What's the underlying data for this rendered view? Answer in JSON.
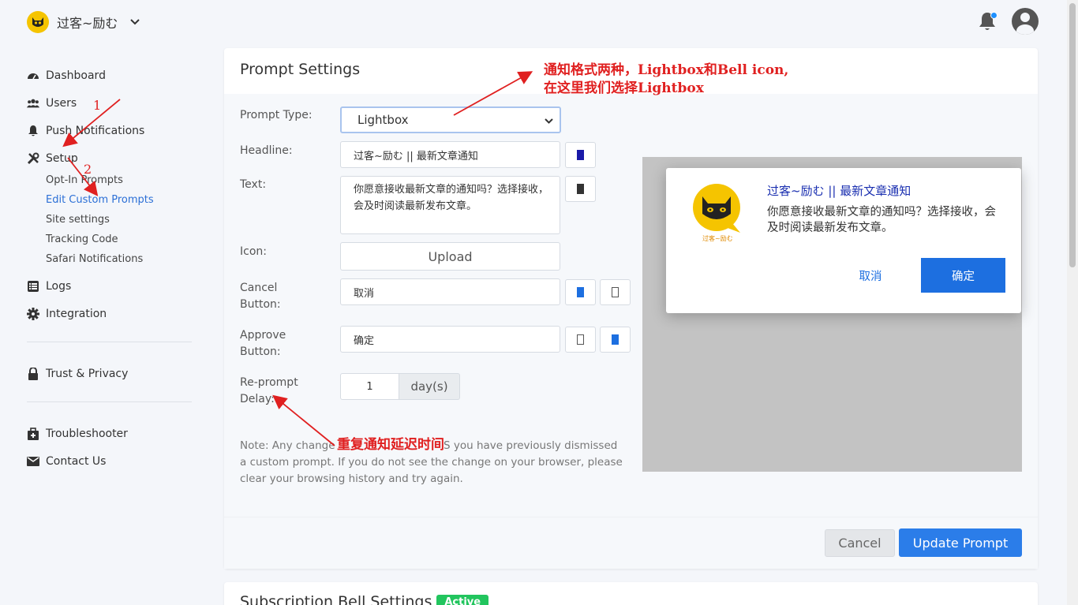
{
  "brand": {
    "name": "过客~励む"
  },
  "sidebar": {
    "items": [
      {
        "label": "Dashboard",
        "icon": "dashboard-icon"
      },
      {
        "label": "Users",
        "icon": "users-icon"
      },
      {
        "label": "Push Notifications",
        "icon": "bell-icon"
      },
      {
        "label": "Setup",
        "icon": "tools-icon"
      }
    ],
    "setup_sub": [
      "Opt-In Prompts",
      "Edit Custom Prompts",
      "Site settings",
      "Tracking Code",
      "Safari Notifications"
    ],
    "items2": [
      {
        "label": "Logs",
        "icon": "list-icon"
      },
      {
        "label": "Integration",
        "icon": "gear-icon"
      }
    ],
    "trust": "Trust & Privacy",
    "troubleshooter": "Troubleshooter",
    "contact": "Contact Us"
  },
  "prompt": {
    "title": "Prompt Settings",
    "type_label": "Prompt Type:",
    "type_value": "Lightbox",
    "headline_label": "Headline:",
    "headline_value": "过客~励む || 最新文章通知",
    "text_label": "Text:",
    "text_value": "你愿意接收最新文章的通知吗？选择接收，会及时阅读最新发布文章。",
    "icon_label": "Icon:",
    "upload_label": "Upload",
    "cancel_label_1": "Cancel",
    "cancel_label_2": "Button:",
    "cancel_value": "取消",
    "approve_label_1": "Approve",
    "approve_label_2": "Button:",
    "approve_value": "确定",
    "reprompt_label_1": "Re-prompt",
    "reprompt_label_2": "Delay:",
    "reprompt_value": "1",
    "reprompt_unit": "day(s)",
    "note": "Note: Any change          immediately UNLESS you have previously dismissed a custom prompt. If you do not see the change on your browser, please clear your browsing history and try again.",
    "cancel_button": "Cancel",
    "update_button": "Update Prompt"
  },
  "preview": {
    "logo_text": "过客~励む",
    "headline": "过客~励む || 最新文章通知",
    "text": "你愿意接收最新文章的通知吗？选择接收，会及时阅读最新发布文章。",
    "cancel": "取消",
    "ok": "确定"
  },
  "bell_settings": {
    "title": "Subscription Bell Settings",
    "badge": "Active"
  },
  "annotations": {
    "top_line1": "通知格式两种，Lightbox和Bell icon,",
    "top_line2": "在这里我们选择Lightbox",
    "delay": "重复通知延迟时间",
    "mark1": "1",
    "mark2": "2"
  },
  "colors": {
    "accent": "#2b7de9",
    "active_link": "#2b6fd6",
    "annotation": "#e02020",
    "badge": "#22c55e"
  }
}
